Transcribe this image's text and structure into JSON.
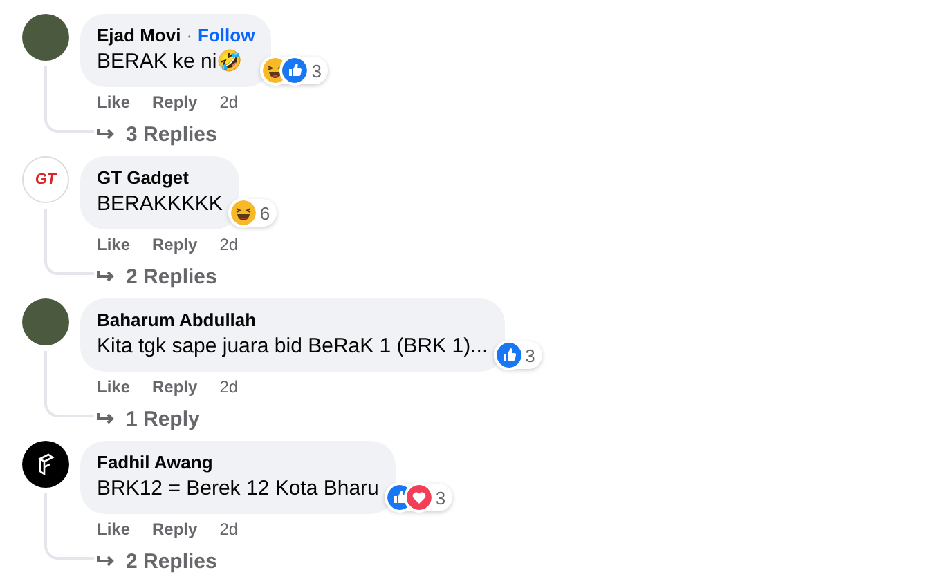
{
  "comments": [
    {
      "author": "Ejad Movi",
      "separator": "·",
      "follow": "Follow",
      "avatar": {
        "kind": "photo"
      },
      "text": "BERAK ke ni🤣",
      "reactions": {
        "types": [
          {
            "kind": "haha"
          },
          {
            "kind": "like"
          }
        ],
        "count": "3"
      },
      "actions": [
        "Like",
        "Reply"
      ],
      "time": "2d",
      "replies": "3 Replies"
    },
    {
      "author": "GT Gadget",
      "avatar": {
        "kind": "logo",
        "text": "GT"
      },
      "text": "BERAKKKKK",
      "reactions": {
        "types": [
          {
            "kind": "haha"
          }
        ],
        "count": "6"
      },
      "actions": [
        "Like",
        "Reply"
      ],
      "time": "2d",
      "replies": "2 Replies"
    },
    {
      "author": "Baharum Abdullah",
      "avatar": {
        "kind": "photo"
      },
      "text": "Kita tgk sape juara bid BeRaK 1 (BRK 1)...",
      "reactions": {
        "types": [
          {
            "kind": "like"
          }
        ],
        "count": "3"
      },
      "actions": [
        "Like",
        "Reply"
      ],
      "time": "2d",
      "replies": "1 Reply"
    },
    {
      "author": "Fadhil Awang",
      "avatar": {
        "kind": "mark"
      },
      "text": "BRK12 = Berek 12 Kota Bharu",
      "reactions": {
        "types": [
          {
            "kind": "like"
          },
          {
            "kind": "love"
          }
        ],
        "count": "3"
      },
      "actions": [
        "Like",
        "Reply"
      ],
      "time": "2d",
      "replies": "2 Replies"
    }
  ]
}
